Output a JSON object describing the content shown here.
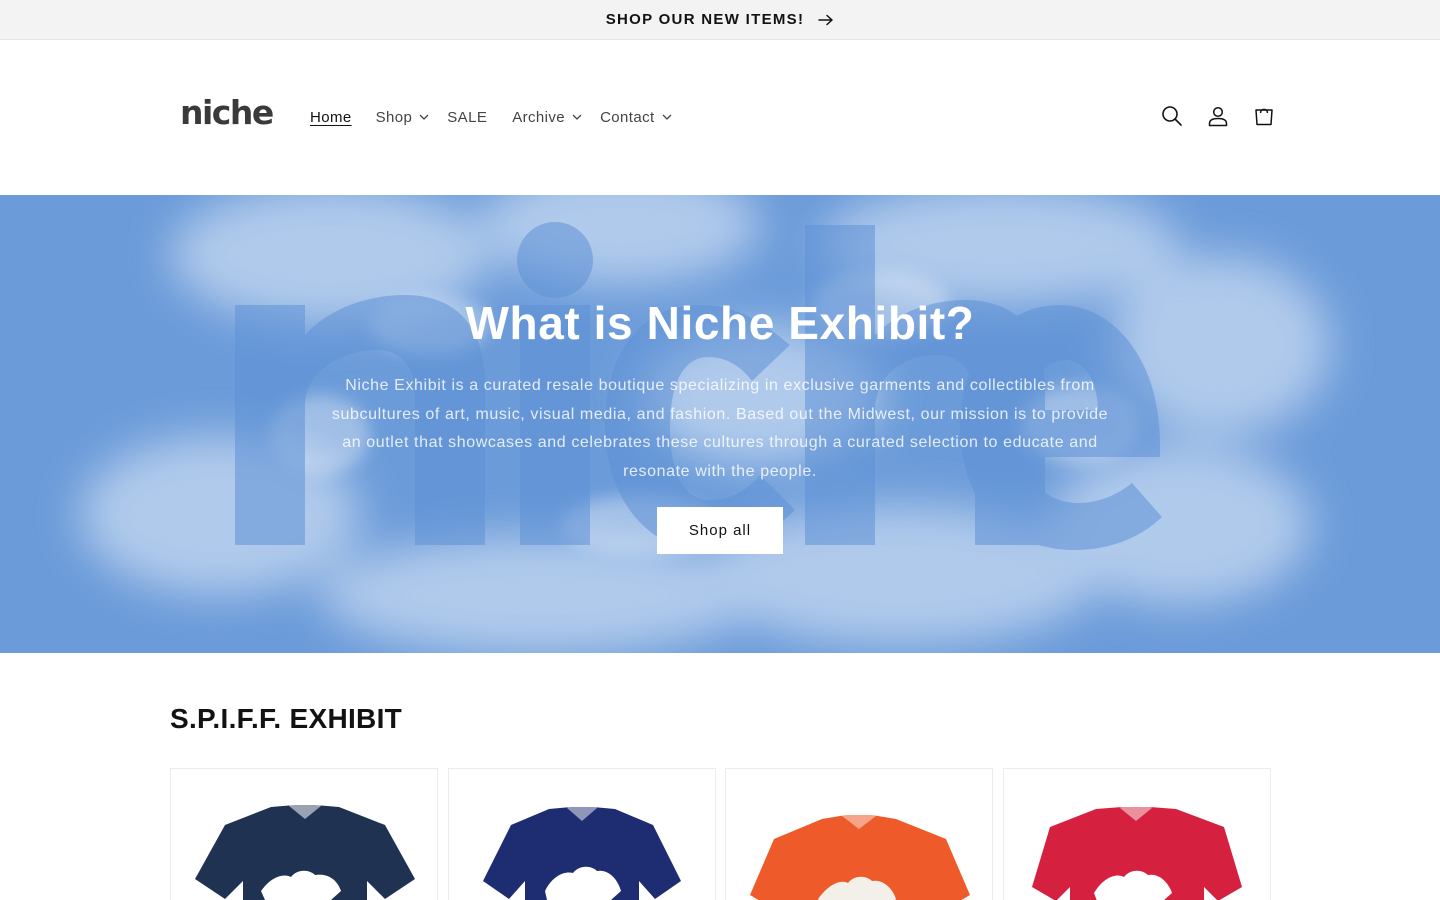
{
  "announcement": {
    "text": "SHOP OUR NEW ITEMS!",
    "arrow_icon": "arrow-right-icon"
  },
  "header": {
    "logo": "niche",
    "nav": [
      {
        "label": "Home",
        "active": true,
        "has_dropdown": false
      },
      {
        "label": "Shop",
        "active": false,
        "has_dropdown": true
      },
      {
        "label": "SALE",
        "active": false,
        "has_dropdown": false
      },
      {
        "label": "Archive",
        "active": false,
        "has_dropdown": true
      },
      {
        "label": "Contact",
        "active": false,
        "has_dropdown": true
      }
    ],
    "icons": [
      "search-icon",
      "account-icon",
      "cart-icon"
    ]
  },
  "hero": {
    "title": "What is Niche Exhibit?",
    "text": "Niche Exhibit is a curated resale boutique specializing in exclusive garments and collectibles from subcultures of art, music, visual media, and fashion. Based out the Midwest, our mission is to provide an outlet that showcases and celebrates these cultures through a curated selection to educate and resonate with the people.",
    "button": "Shop all",
    "background_color": "#6b9bd9"
  },
  "collection": {
    "title": "S.P.I.F.F. EXHIBIT",
    "products": [
      {
        "color": "#1f3252"
      },
      {
        "color": "#1e2d72"
      },
      {
        "color": "#ee5a2a"
      },
      {
        "color": "#d6203f"
      }
    ]
  }
}
